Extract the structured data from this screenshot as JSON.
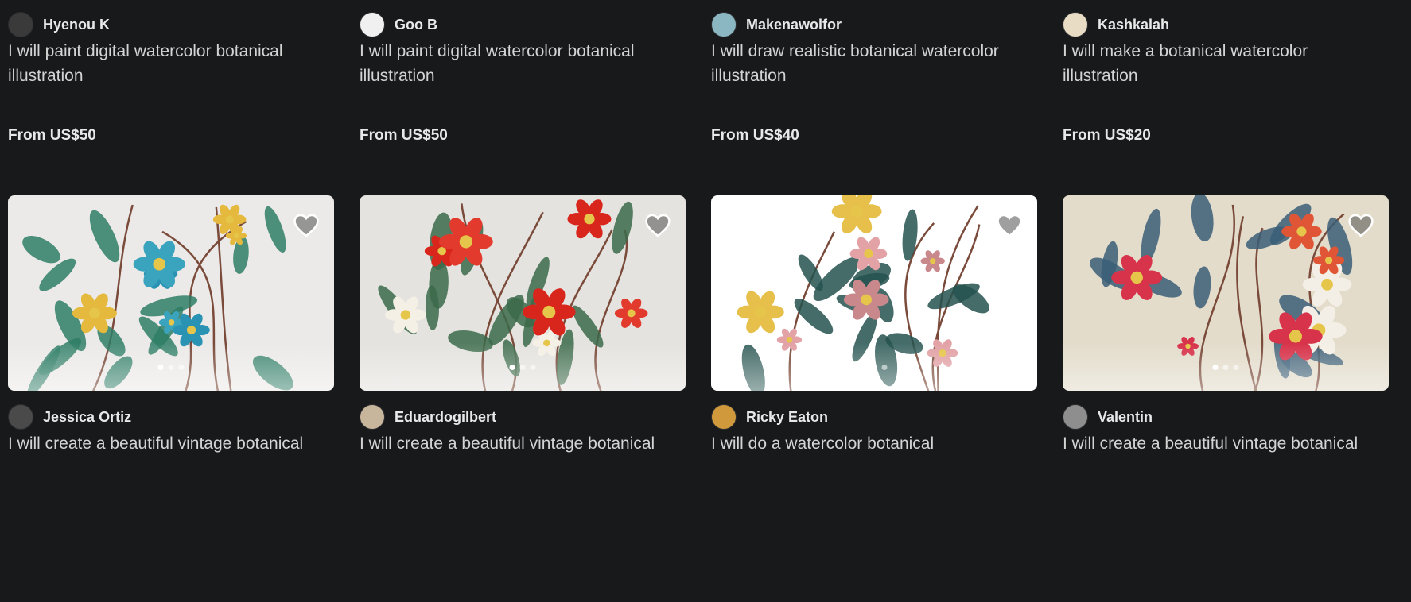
{
  "colors": {
    "background": "#18191b",
    "text_primary": "#e8e8e8",
    "text_secondary": "#d4d4d4"
  },
  "cards": [
    {
      "seller": "Hyenou K",
      "title": "I will paint digital watercolor botanical illustration",
      "price": "From US$50",
      "favorite_icon": false,
      "carousel_dots": 3,
      "thumb_bg": "#ecebe3",
      "flowers": [
        "#e8906a",
        "#c94a48",
        "#6f8fd0"
      ],
      "leaf": "#52703c",
      "avatar_color": "#3a3a3a"
    },
    {
      "seller": "Goo B",
      "title": "I will paint digital watercolor botanical illustration",
      "price": "From US$50",
      "favorite_icon": false,
      "carousel_dots": 3,
      "thumb_bg": "#efeada",
      "flowers": [
        "#f2e8c8",
        "#d78884",
        "#e7b453"
      ],
      "leaf": "#4f6e4e",
      "avatar_color": "#f0f0f0"
    },
    {
      "seller": "Makenawolfor",
      "title": "I will draw realistic botanical watercolor illustration",
      "price": "From US$40",
      "favorite_icon": false,
      "carousel_dots": 3,
      "thumb_bg": "#ded3bd",
      "flowers": [
        "#e8c56a",
        "#d9a743",
        "#7f9a5c"
      ],
      "leaf": "#3c6658",
      "avatar_color": "#8bb7c2"
    },
    {
      "seller": "Kashkalah",
      "title": "I will make a botanical watercolor illustration",
      "price": "From US$20",
      "favorite_icon": false,
      "carousel_dots": 3,
      "thumb_bg": "#f6f2e2",
      "flowers": [
        "#f5f2ea",
        "#d7c7a8",
        "#c9a890"
      ],
      "leaf": "#3c7a3a",
      "avatar_color": "#e8ddc4"
    },
    {
      "seller": "Jessica Ortiz",
      "title": "I will create a beautiful vintage botanical",
      "price": "",
      "favorite_icon": true,
      "carousel_dots": 3,
      "thumb_bg": "#eceae8",
      "flowers": [
        "#e4b93d",
        "#2a93b3",
        "#3aa3bd"
      ],
      "leaf": "#2f7e66",
      "avatar_color": "#4a4a4a"
    },
    {
      "seller": "Eduardogilbert",
      "title": "I will create a beautiful vintage botanical",
      "price": "",
      "favorite_icon": true,
      "carousel_dots": 3,
      "thumb_bg": "#e5e3df",
      "flowers": [
        "#d9261c",
        "#f4f0e6",
        "#e23a2c"
      ],
      "leaf": "#3b6a4a",
      "avatar_color": "#c7b59c"
    },
    {
      "seller": "Ricky Eaton",
      "title": "I will do a watercolor botanical",
      "price": "",
      "favorite_icon": true,
      "carousel_dots": 3,
      "thumb_bg": "#ffffff",
      "flowers": [
        "#e2a2a6",
        "#c9888c",
        "#e6c04b"
      ],
      "leaf": "#24524f",
      "avatar_color": "#d09a3c"
    },
    {
      "seller": "Valentin",
      "title": "I will create a beautiful vintage botanical",
      "price": "",
      "favorite_icon": true,
      "carousel_dots": 3,
      "thumb_bg": "#e3dccb",
      "flowers": [
        "#d7334a",
        "#f4efe6",
        "#e05536"
      ],
      "leaf": "#3b5e78",
      "avatar_color": "#8e8e8e"
    }
  ]
}
